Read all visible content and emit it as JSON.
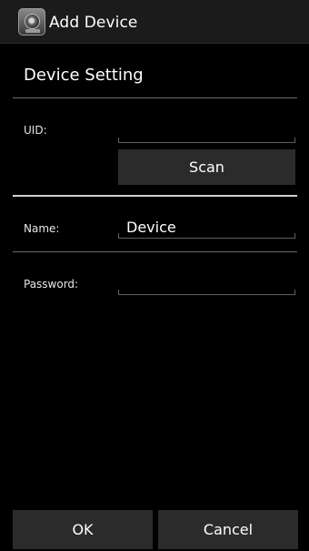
{
  "titlebar": {
    "title": "Add Device",
    "icon": "camera-icon"
  },
  "section": {
    "title": "Device Setting"
  },
  "fields": {
    "uid": {
      "label": "UID:",
      "value": ""
    },
    "name": {
      "label": "Name:",
      "value": "Device"
    },
    "password": {
      "label": "Password:",
      "value": ""
    }
  },
  "buttons": {
    "scan": "Scan",
    "ok": "OK",
    "cancel": "Cancel"
  },
  "colors": {
    "background": "#000000",
    "titlebar": "#1b1b1b",
    "button": "#2b2b2b",
    "divider": "#6a6a6a"
  }
}
